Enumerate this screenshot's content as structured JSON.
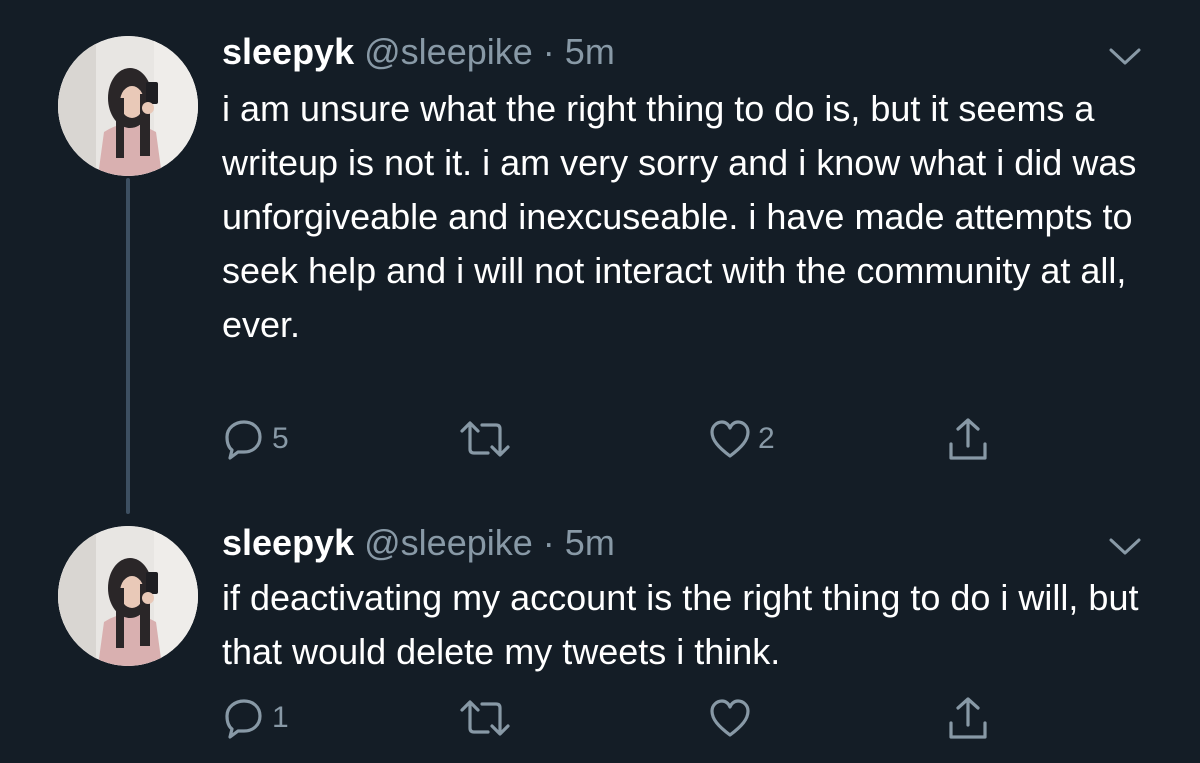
{
  "tweets": [
    {
      "display_name": "sleepyk",
      "handle": "@sleepike",
      "separator": "·",
      "time": "5m",
      "text": "i am unsure what the right thing to do is, but it seems a writeup is not it. i am very sorry and i know what i did was unforgiveable and inexcuseable. i have made attempts to seek help and i will not interact with the community at all, ever.",
      "reply_count": "5",
      "retweet_count": "",
      "like_count": "2"
    },
    {
      "display_name": "sleepyk",
      "handle": "@sleepike",
      "separator": "·",
      "time": "5m",
      "text": "if deactivating my account is the right thing to do i will, but that would delete my tweets i think.",
      "reply_count": "1",
      "retweet_count": "",
      "like_count": ""
    }
  ],
  "icons": {
    "reply": "reply-icon",
    "retweet": "retweet-icon",
    "like": "heart-icon",
    "share": "share-icon",
    "caret": "chevron-down-icon"
  },
  "colors": {
    "background": "#141d26",
    "text": "#ffffff",
    "secondary": "#8899a6",
    "thread_line": "#3d4f61"
  }
}
